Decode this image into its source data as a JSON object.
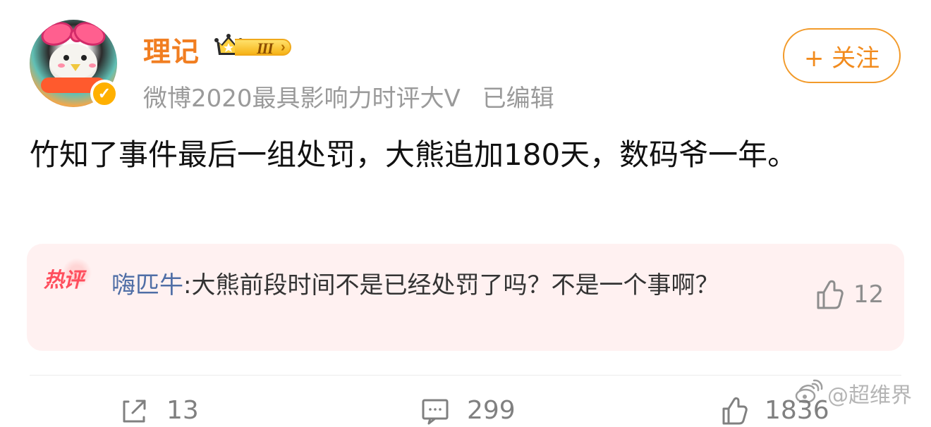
{
  "header": {
    "username": "理记",
    "vip_level": "III",
    "meta_title": "微博2020最具影响力时评大V",
    "edited": "已编辑",
    "follow_label": "+ 关注"
  },
  "post": {
    "content": "竹知了事件最后一组处罚，大熊追加180天，数码爷一年。"
  },
  "hot_comment": {
    "label": "热评",
    "author": "嗨匹牛",
    "separator": ":",
    "text": "大熊前段时间不是已经处罚了吗？不是一个事啊？",
    "likes": "12"
  },
  "actions": {
    "share_count": "13",
    "comment_count": "299",
    "like_count": "1836"
  },
  "watermark": {
    "text": "@超维界"
  },
  "colors": {
    "accent_orange": "#f17e21",
    "link_blue": "#4f6ea6",
    "hot_red": "#ff4e5d",
    "comment_bg": "#fff1f1"
  },
  "icons": {
    "verified": "verified-icon",
    "crown": "crown-icon",
    "follow_plus": "plus-icon",
    "thumb_up": "thumb-up-icon",
    "share": "share-icon",
    "comment": "comment-icon",
    "weibo_logo": "weibo-logo-icon"
  }
}
